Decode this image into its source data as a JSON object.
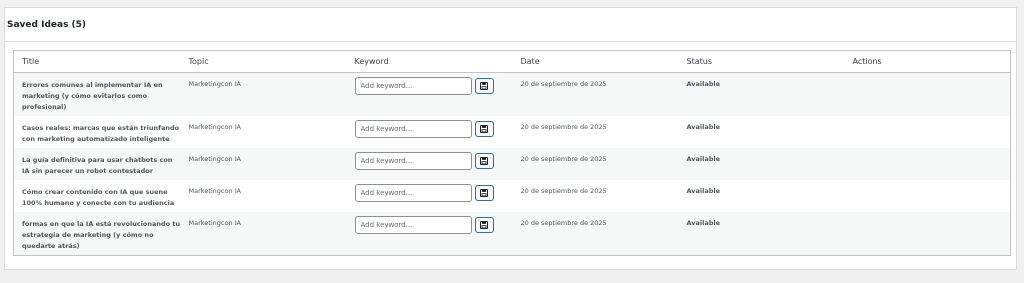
{
  "panel": {
    "title": "Saved Ideas (5)"
  },
  "table": {
    "headers": {
      "title": "Title",
      "topic": "Topic",
      "keyword": "Keyword",
      "date": "Date",
      "status": "Status",
      "actions": "Actions"
    },
    "keyword_placeholder": "Add keyword...",
    "rows": [
      {
        "title": "Errores comunes al implementar IA en marketing (y cómo evitarlos como profesional)",
        "topic": "Marketingcon IA",
        "date": "20 de septiembre de 2025",
        "status": "Available"
      },
      {
        "title": "Casos reales: marcas que están triunfando con marketing automatizado inteligente",
        "topic": "Marketingcon IA",
        "date": "20 de septiembre de 2025",
        "status": "Available"
      },
      {
        "title": "La guía definitiva para usar chatbots con IA sin parecer un robot contestador",
        "topic": "Marketingcon IA",
        "date": "20 de septiembre de 2025",
        "status": "Available"
      },
      {
        "title": "Cómo crear contenido con IA que suene 100% humano y conecte con tu audiencia",
        "topic": "Marketingcon IA",
        "date": "20 de septiembre de 2025",
        "status": "Available"
      },
      {
        "title": "formas en que la IA está revolucionando tu estrategia de marketing (y cómo no quedarte atrás)",
        "topic": "Marketingcon IA",
        "date": "20 de septiembre de 2025",
        "status": "Available"
      }
    ]
  },
  "icons": {
    "save": "floppy-disk-icon"
  },
  "colors": {
    "status_available": "#00a32a",
    "button_border": "#2271b1"
  }
}
